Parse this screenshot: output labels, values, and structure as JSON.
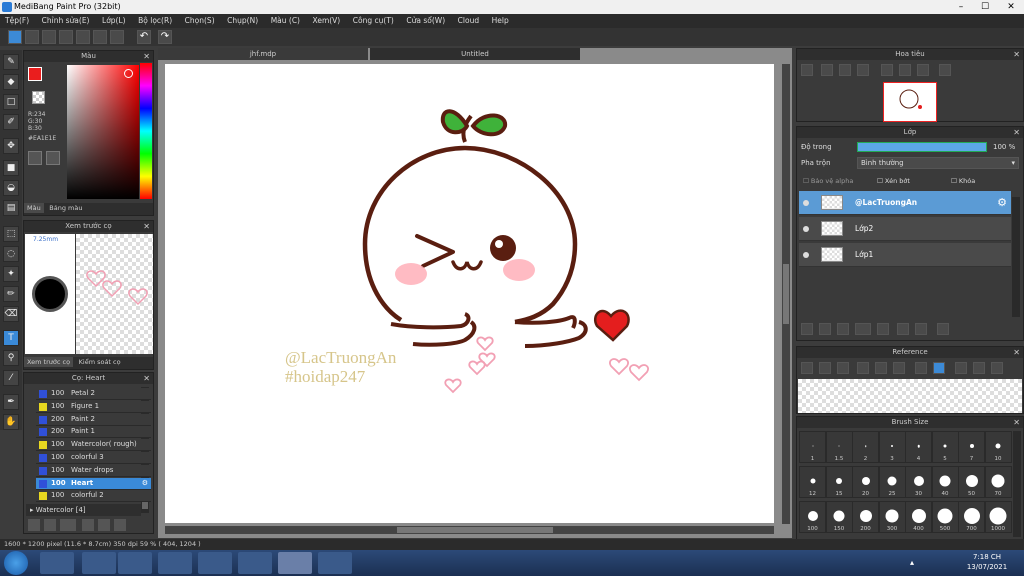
{
  "window": {
    "title": "MediBang Paint Pro (32bit)",
    "min": "–",
    "max": "☐",
    "close": "✕"
  },
  "menu": [
    "Tệp(F)",
    "Chỉnh sửa(E)",
    "Lớp(L)",
    "Bộ lọc(R)",
    "Chọn(S)",
    "Chụp(N)",
    "Màu (C)",
    "Xem(V)",
    "Công cụ(T)",
    "Cửa sổ(W)",
    "Cloud",
    "Help"
  ],
  "tabs": {
    "doc1": "jhf.mdp",
    "doc2": "Untitled"
  },
  "color_panel": {
    "title": "Màu",
    "primary": "#ea1e1e",
    "r": "R:234",
    "g": "G:30",
    "b": "B:30",
    "hex": "#EA1E1E",
    "tab_color": "Màu",
    "tab_palette": "Bảng màu"
  },
  "preview_panel": {
    "title": "Xem trước cọ",
    "size": "7.25mm",
    "tab1": "Xem trước cọ",
    "tab2": "Kiểm soát cọ"
  },
  "brush_panel": {
    "title": "Cọ: Heart",
    "items": [
      {
        "size": "100",
        "name": "Petal 2",
        "color": "#3050d8"
      },
      {
        "size": "100",
        "name": "Figure 1",
        "color": "#e8d820"
      },
      {
        "size": "200",
        "name": "Paint 2",
        "color": "#3050d8"
      },
      {
        "size": "200",
        "name": "Paint 1",
        "color": "#3050d8"
      },
      {
        "size": "100",
        "name": "Watercolor( rough)",
        "color": "#e8d820"
      },
      {
        "size": "100",
        "name": "colorful 3",
        "color": "#3050d8"
      },
      {
        "size": "100",
        "name": "Water drops",
        "color": "#3050d8"
      },
      {
        "size": "100",
        "name": "Heart",
        "color": "#3050d8"
      },
      {
        "size": "100",
        "name": "colorful 2",
        "color": "#e8d820"
      }
    ],
    "group": "Watercolor [4]"
  },
  "navigator": {
    "title": "Hoa tiêu"
  },
  "layer_panel": {
    "title": "Lớp",
    "opacity_label": "Độ trong",
    "opacity_value": "100 %",
    "blend_label": "Pha trộn",
    "blend_value": "Bình thường",
    "protect_alpha": "Bảo vệ alpha",
    "clipping": "Xén bớt",
    "lock": "Khóa",
    "layers": [
      "@LacTruongAn",
      "Lớp2",
      "Lớp1"
    ]
  },
  "reference_panel": {
    "title": "Reference"
  },
  "brush_size_panel": {
    "title": "Brush Size",
    "sizes": [
      "1",
      "1.5",
      "2",
      "3",
      "4",
      "5",
      "7",
      "10",
      "12",
      "15",
      "20",
      "25",
      "30",
      "40",
      "50",
      "70",
      "100",
      "150",
      "200",
      "300",
      "400",
      "500",
      "700",
      "1000"
    ]
  },
  "canvas": {
    "watermark1": "@LacTruongAn",
    "watermark2": "#hoidap247"
  },
  "status": {
    "text": "1600 * 1200 pixel  (11.6 * 8.7cm)  350 dpi  59 %  ( 404, 1204 )"
  },
  "taskbar": {
    "time": "7:18 CH",
    "date": "13/07/2021"
  }
}
